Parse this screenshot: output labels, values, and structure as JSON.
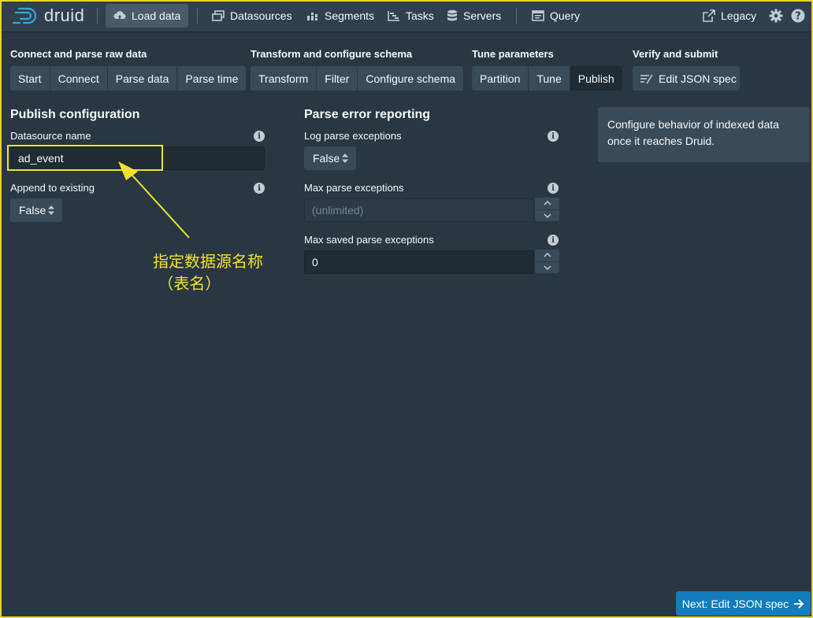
{
  "nav": {
    "brand": "druid",
    "items": [
      {
        "label": "Load data",
        "icon": "cloud-upload-icon",
        "active": true
      },
      {
        "label": "Datasources",
        "icon": "multi-select-icon"
      },
      {
        "label": "Segments",
        "icon": "stacked-chart-icon"
      },
      {
        "label": "Tasks",
        "icon": "gantt-chart-icon"
      },
      {
        "label": "Servers",
        "icon": "database-icon"
      },
      {
        "label": "Query",
        "icon": "application-icon"
      }
    ],
    "legacy": "Legacy"
  },
  "steps": {
    "connect": {
      "title": "Connect and parse raw data",
      "buttons": [
        "Start",
        "Connect",
        "Parse data",
        "Parse time"
      ]
    },
    "transform": {
      "title": "Transform and configure schema",
      "buttons": [
        "Transform",
        "Filter",
        "Configure schema"
      ]
    },
    "tune": {
      "title": "Tune parameters",
      "buttons": [
        "Partition",
        "Tune",
        "Publish"
      ]
    },
    "verify": {
      "title": "Verify and submit",
      "button": "Edit JSON spec"
    }
  },
  "publish": {
    "title": "Publish configuration",
    "datasource_label": "Datasource name",
    "datasource_value": "ad_event",
    "append_label": "Append to existing",
    "append_value": "False"
  },
  "parse_error": {
    "title": "Parse error reporting",
    "log_label": "Log parse exceptions",
    "log_value": "False",
    "max_label": "Max parse exceptions",
    "max_placeholder": "(unlimited)",
    "saved_label": "Max saved parse exceptions",
    "saved_value": "0"
  },
  "help": {
    "text": "Configure behavior of indexed data once it reaches Druid."
  },
  "annotation": {
    "line1": "指定数据源名称",
    "line2": "（表名）"
  },
  "footer": {
    "next_label": "Next: Edit JSON spec"
  },
  "colors": {
    "accent": "#137cbd",
    "highlight": "#f0e130",
    "background": "#293742"
  }
}
